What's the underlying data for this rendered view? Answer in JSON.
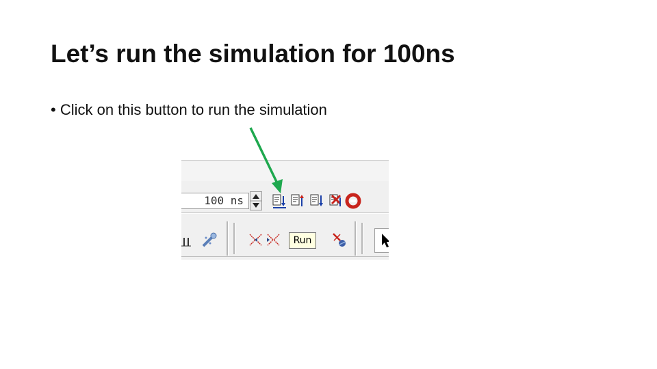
{
  "slide": {
    "title": "Let’s run the simulation for 100ns",
    "bullet": "• Click on this button to run the simulation"
  },
  "toolbar": {
    "run_time_value": "100 ns",
    "tooltip": "Run",
    "icons": [
      "run-length-icon",
      "run-continue-icon",
      "run-all-icon",
      "break-icon",
      "restart-icon",
      "expand-icon",
      "collapse-icon",
      "step-icon",
      "cursor-icon"
    ]
  },
  "colors": {
    "arrow": "#1ea84e",
    "icon_blue": "#1a3fa8",
    "icon_red": "#c8241c",
    "tooltip_bg": "#ffffe1"
  }
}
